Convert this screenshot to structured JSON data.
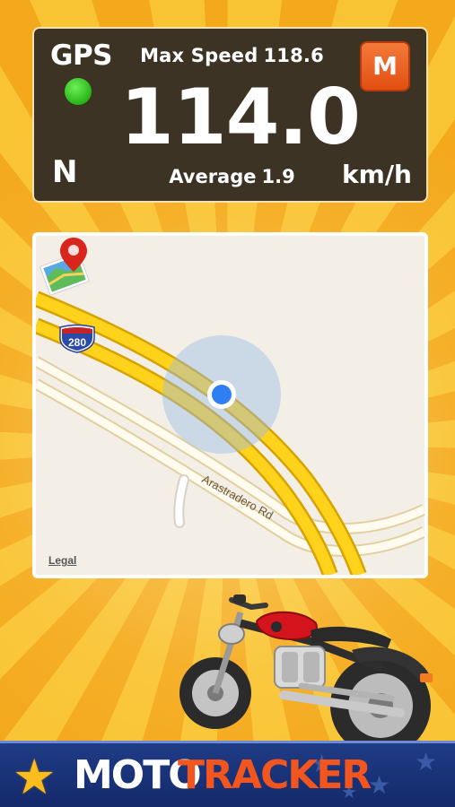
{
  "speedometer": {
    "gps_label": "GPS",
    "gps_status_color": "#2fc11c",
    "heading": "N",
    "max_speed_label": "Max Speed",
    "max_speed_value": "118.6",
    "current_speed": "114.0",
    "average_label": "Average",
    "average_value": "1.9",
    "unit": "km/h",
    "mode_button_label": "M"
  },
  "map": {
    "highway_shield": "280",
    "road_name": "Arastradero Rd",
    "legal_link": "Legal",
    "location_icon": "current-location-dot",
    "toggle_icon": "map-pin-icon"
  },
  "brand": {
    "name_part1": "MOTO",
    "name_part2": "TRACKER",
    "icon": "star-icon"
  }
}
